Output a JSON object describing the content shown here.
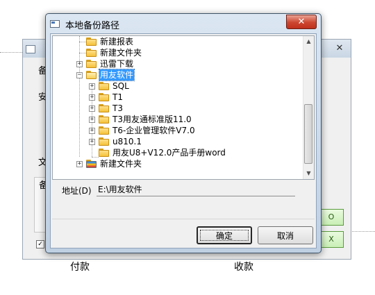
{
  "dialog": {
    "title": "本地备份路径",
    "close_label": "✕",
    "address_label": "地址(D)",
    "address_value": "E:\\用友软件",
    "ok_label": "确定",
    "cancel_label": "取消"
  },
  "tree": {
    "nodes": [
      {
        "label": "新建报表"
      },
      {
        "label": "新建文件夹"
      },
      {
        "label": "迅雷下载",
        "expander": "+"
      },
      {
        "label": "用友软件",
        "expander": "−",
        "selected": true
      },
      {
        "label": "SQL",
        "expander": "+"
      },
      {
        "label": "T1",
        "expander": "+"
      },
      {
        "label": "T3",
        "expander": "+"
      },
      {
        "label": "T3用友通标准版11.0",
        "expander": "+"
      },
      {
        "label": "T6-企业管理软件V7.0",
        "expander": "+"
      },
      {
        "label": "u810.1",
        "expander": "+"
      },
      {
        "label": "用友U8+V12.0产品手册word"
      },
      {
        "label": "新建文件夹",
        "expander": "+"
      }
    ]
  },
  "background": {
    "left_chars": [
      "备",
      "安",
      "文",
      "备"
    ],
    "btn1": "O",
    "btn2": "X",
    "bottom_left": "付款",
    "bottom_right": "收款",
    "check_mark": "✓",
    "close": "✕"
  },
  "scrollbar": {
    "up": "▲",
    "down": "▼"
  },
  "colors": {
    "selection": "#3399ff",
    "close_button": "#c8402c",
    "folder": "#f5c23a"
  }
}
